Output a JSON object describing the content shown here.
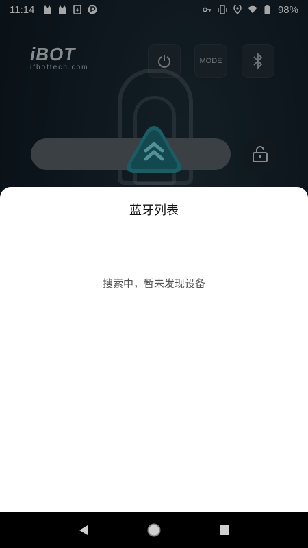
{
  "status_bar": {
    "time": "11:14",
    "battery": "98%",
    "left_icons": [
      "cat-app-icon",
      "cat-app-icon",
      "download-icon",
      "parking-icon"
    ],
    "right_icons": [
      "key-icon",
      "vibrate-icon",
      "location-icon",
      "wifi-icon",
      "battery-icon"
    ]
  },
  "app": {
    "logo_main": "iBOT",
    "logo_sub": "ifbottech.com",
    "buttons": {
      "power_icon": "power-icon",
      "mode_label": "MODE",
      "bluetooth_icon": "bluetooth-icon",
      "forward_icon": "double-chevron-up-icon",
      "lock_icon": "unlock-icon"
    }
  },
  "sheet": {
    "title": "蓝牙列表",
    "status": "搜索中，暂未发现设备"
  },
  "nav": {
    "back_icon": "back-icon",
    "home_icon": "home-icon",
    "recents_icon": "recents-icon"
  },
  "colors": {
    "background": "#13202a",
    "sheet": "#ffffff",
    "accent": "#2aa3b0",
    "nav_bar": "#000000"
  }
}
